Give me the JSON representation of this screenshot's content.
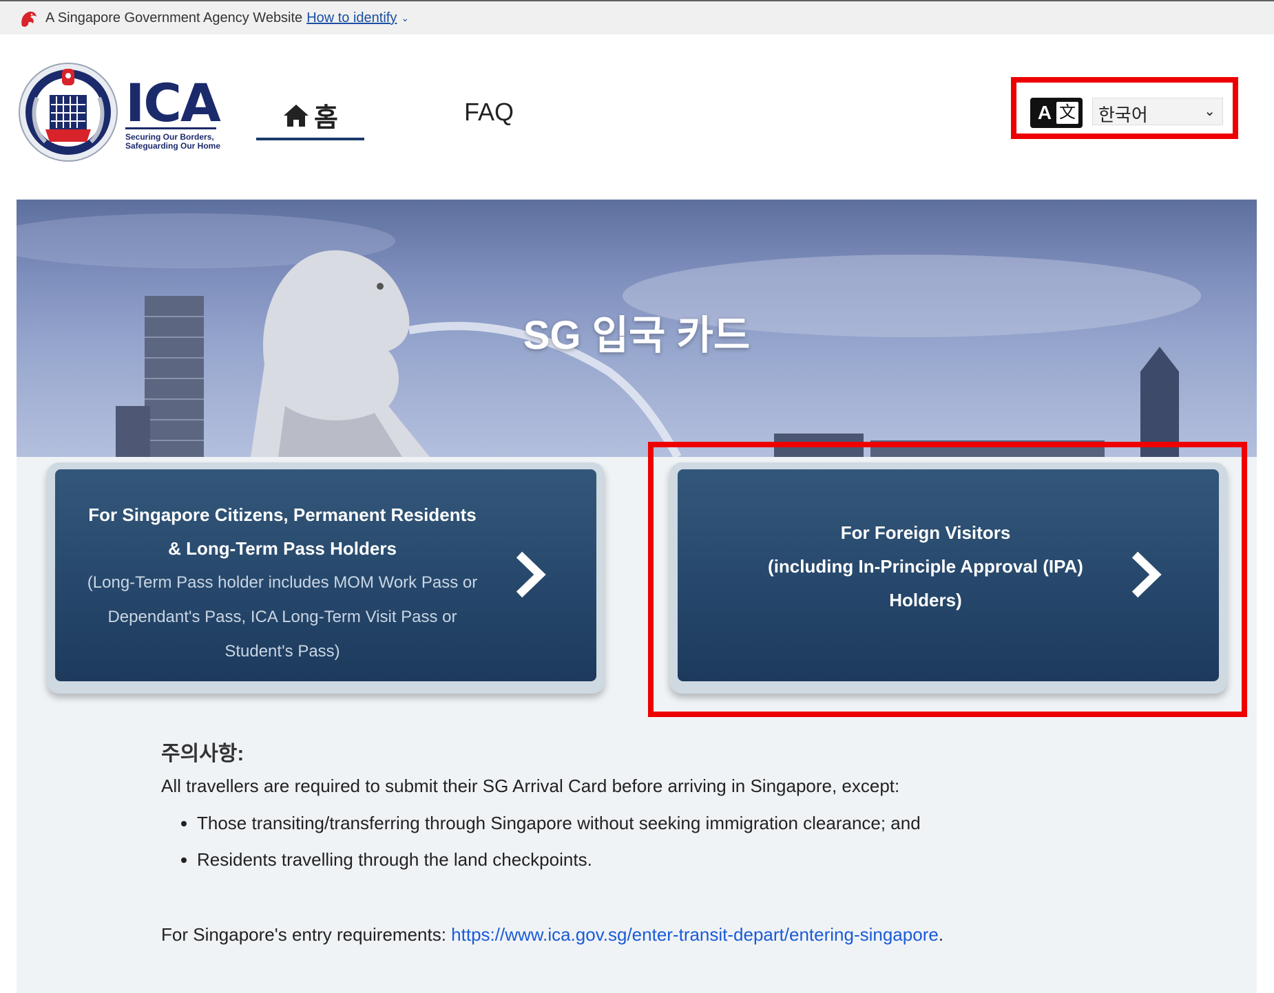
{
  "masthead": {
    "agency_text": "A Singapore Government Agency Website",
    "identify_link": "How to identify"
  },
  "header": {
    "logo_text": "ICA",
    "logo_tagline_line1": "Securing Our Borders,",
    "logo_tagline_line2": "Safeguarding Our Home",
    "nav": {
      "home_label": "홈",
      "faq_label": "FAQ"
    },
    "language": {
      "selected": "한국어",
      "icon": "translate-icon"
    }
  },
  "hero": {
    "title": "SG 입국 카드"
  },
  "cards": {
    "residents": {
      "title_line1": "For Singapore Citizens, Permanent Residents",
      "title_line2": "& Long-Term Pass Holders",
      "sub_line1": "(Long-Term Pass holder includes MOM Work Pass or",
      "sub_line2": "Dependant's Pass, ICA Long-Term Visit Pass or",
      "sub_line3": "Student's Pass)"
    },
    "visitors": {
      "line1": "For Foreign Visitors",
      "line2": "(including In-Principle Approval (IPA)",
      "line3": "Holders)"
    }
  },
  "notice": {
    "heading": "주의사항:",
    "intro": "All travellers are required to submit their SG Arrival Card before arriving in Singapore, except:",
    "items": [
      "Those transiting/transferring through Singapore without seeking immigration clearance; and",
      "Residents travelling through the land checkpoints."
    ],
    "entry_label": "For Singapore's entry requirements: ",
    "entry_link": "https://www.ica.gov.sg/enter-transit-depart/entering-singapore",
    "entry_end": "."
  },
  "colors": {
    "navy": "#1b2a6b",
    "card_blue": "#25466a",
    "highlight_red": "#ee0000",
    "link_blue": "#1a5bd6"
  }
}
